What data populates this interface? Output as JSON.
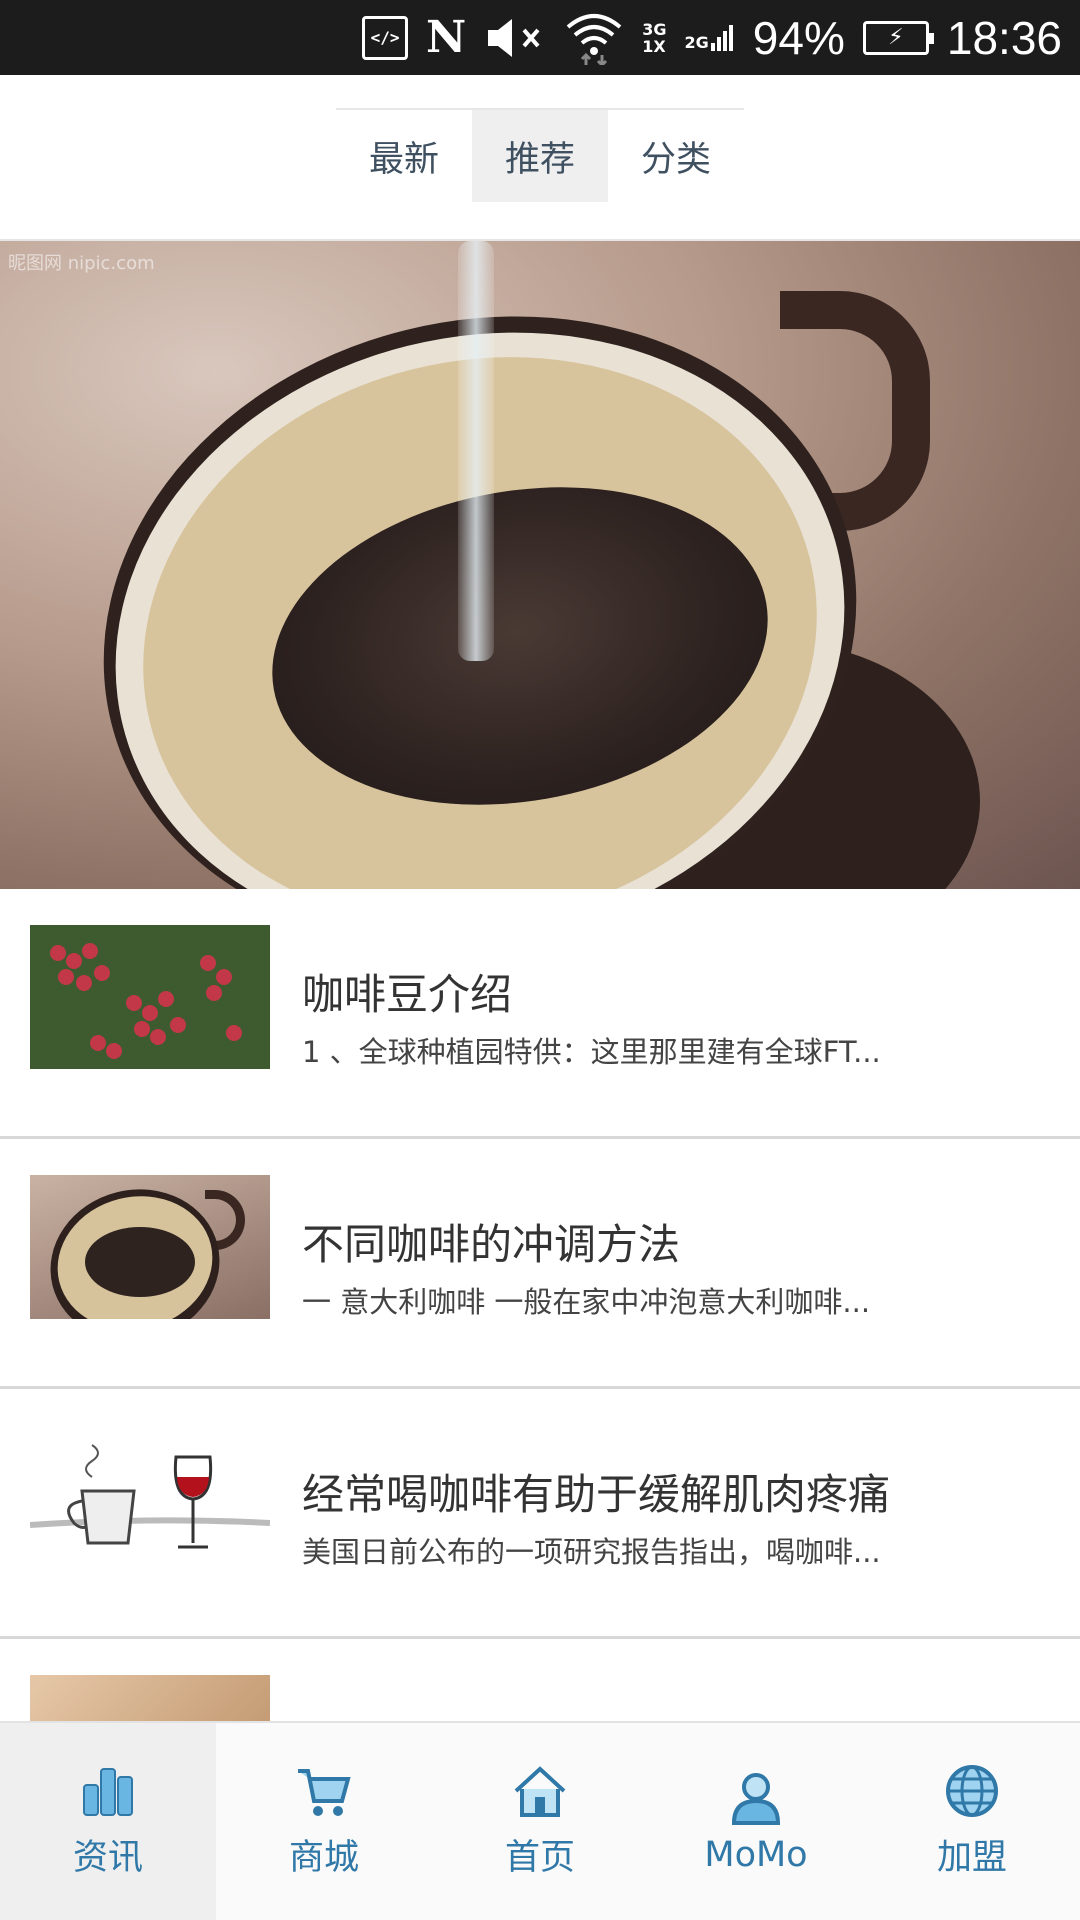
{
  "status_bar": {
    "dev_icon": "</>",
    "nfc_icon": "N",
    "network_3g": "3G",
    "network_1x": "1X",
    "network_2g": "2G",
    "battery_percent": "94%",
    "time": "18:36"
  },
  "top_tabs": [
    {
      "label": "最新",
      "active": false
    },
    {
      "label": "推荐",
      "active": true
    },
    {
      "label": "分类",
      "active": false
    }
  ],
  "banner": {
    "watermark": "昵图网 nipic.com"
  },
  "articles": [
    {
      "title": "咖啡豆介绍",
      "desc": "1 、全球种植园特供：这里那里建有全球FT..."
    },
    {
      "title": "不同咖啡的冲调方法",
      "desc": "一 意大利咖啡 一般在家中冲泡意大利咖啡..."
    },
    {
      "title": "经常喝咖啡有助于缓解肌肉疼痛",
      "desc": "美国日前公布的一项研究报告指出，喝咖啡..."
    },
    {
      "title": "",
      "desc": ""
    }
  ],
  "bottom_nav": [
    {
      "label": "资讯",
      "icon": "chart-bars-icon",
      "active": true
    },
    {
      "label": "商城",
      "icon": "shopping-cart-icon",
      "active": false
    },
    {
      "label": "首页",
      "icon": "home-icon",
      "active": false
    },
    {
      "label": "MoMo",
      "icon": "user-icon",
      "active": false
    },
    {
      "label": "加盟",
      "icon": "globe-icon",
      "active": false
    }
  ],
  "colors": {
    "nav_accent": "#2f78a8",
    "status_bar_bg": "#1c1c1c",
    "tab_text": "#3f5060",
    "active_bg": "#efefef"
  }
}
